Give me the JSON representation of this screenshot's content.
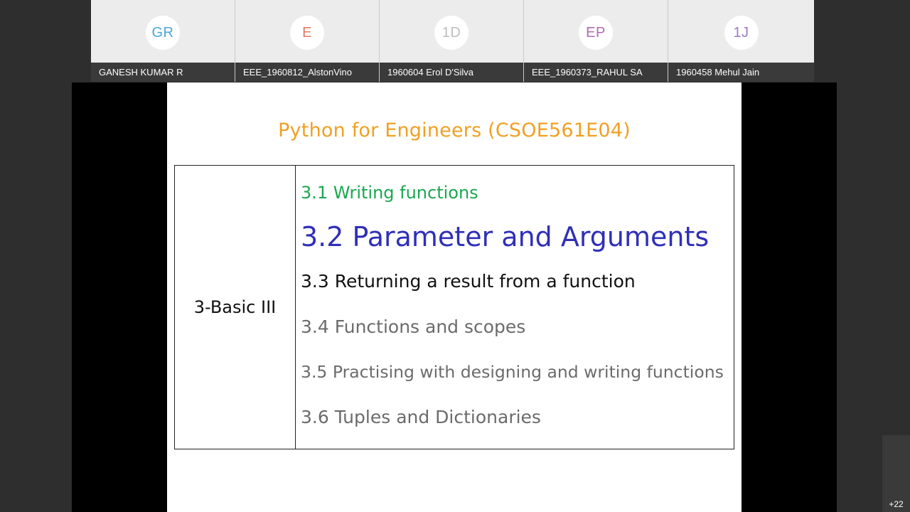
{
  "participants": [
    {
      "initials": "GR",
      "name": "GANESH KUMAR R",
      "color": "#4aa8d8"
    },
    {
      "initials": "E",
      "name": "EEE_1960812_AlstonVino",
      "color": "#e07a5f"
    },
    {
      "initials": "1D",
      "name": "1960604 Erol D'Silva",
      "color": "#bdbdbd"
    },
    {
      "initials": "EP",
      "name": "EEE_1960373_RAHUL SA",
      "color": "#b06ab3"
    },
    {
      "initials": "1J",
      "name": "1960458 Mehul Jain",
      "color": "#9b7bc4"
    }
  ],
  "slide": {
    "title": "Python for Engineers (CSOE561E04)",
    "module": "3-Basic III",
    "topics": [
      {
        "text": "3.1 Writing functions",
        "color": "#1aa84f"
      },
      {
        "text": "3.2 Parameter and Arguments",
        "color": "#2f2fb8"
      },
      {
        "text": "3.3 Returning a result from a function",
        "color": "#111111"
      },
      {
        "text": "3.4 Functions and scopes",
        "color": "#6b6b6b"
      },
      {
        "text": "3.5 Practising with designing and writing functions",
        "color": "#6b6b6b"
      },
      {
        "text": "3.6 Tuples and Dictionaries",
        "color": "#6b6b6b"
      }
    ]
  },
  "overflow": {
    "label": "+22"
  }
}
